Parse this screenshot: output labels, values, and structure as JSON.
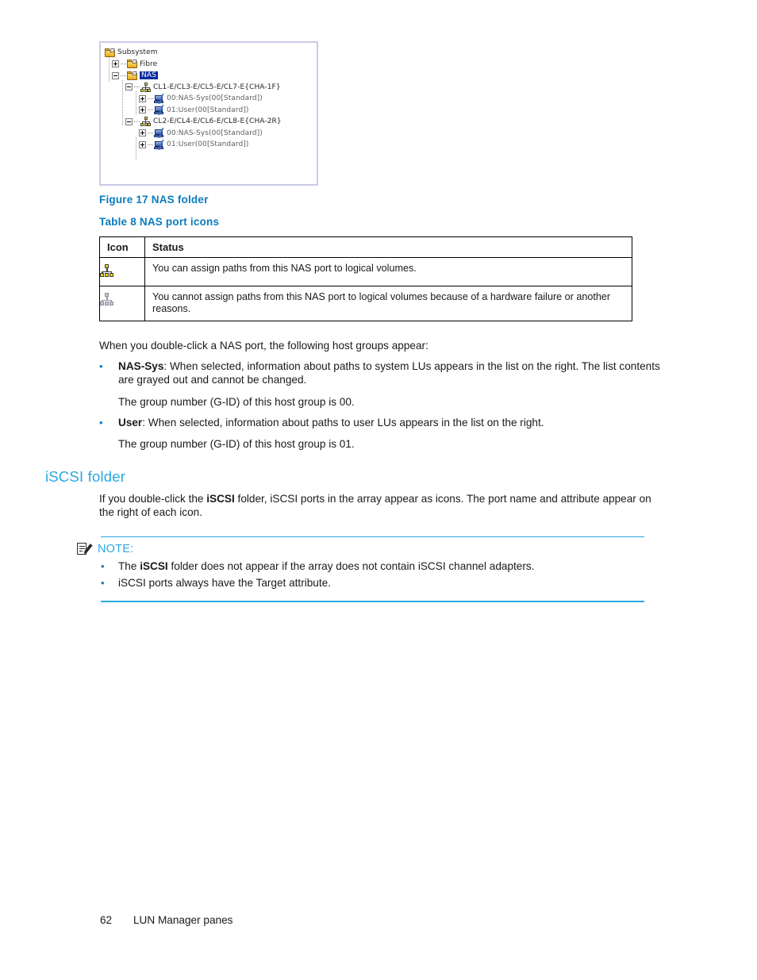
{
  "figure": {
    "caption": "Figure 17 NAS folder",
    "tree": {
      "root": {
        "label": "Subsystem",
        "icon": "folder-icon"
      },
      "nodes": [
        {
          "label": "Fibre",
          "icon": "folder-icon",
          "expander": "plus"
        },
        {
          "label": "NAS",
          "icon": "folder-icon",
          "expander": "minus",
          "selected": true
        },
        {
          "label": "CL1-E/CL3-E/CL5-E/CL7-E{CHA-1F}",
          "icon": "nas-port-icon",
          "expander": "minus"
        },
        {
          "label": "00:NAS-Sys(00[Standard])",
          "icon": "host-group-icon",
          "expander": "plus"
        },
        {
          "label": "01:User(00[Standard])",
          "icon": "host-group-icon",
          "expander": "plus"
        },
        {
          "label": "CL2-E/CL4-E/CL6-E/CL8-E{CHA-2R}",
          "icon": "nas-port-icon",
          "expander": "minus"
        },
        {
          "label": "00:NAS-Sys(00[Standard])",
          "icon": "host-group-icon",
          "expander": "plus"
        },
        {
          "label": "01:User(00[Standard])",
          "icon": "host-group-icon",
          "expander": "plus"
        }
      ]
    }
  },
  "table": {
    "caption": "Table 8 NAS port icons",
    "headers": [
      "Icon",
      "Status"
    ],
    "rows": [
      {
        "icon": "nas-port-available-icon",
        "status": "You can assign paths from this NAS port to logical volumes."
      },
      {
        "icon": "nas-port-unavailable-icon",
        "status": "You cannot assign paths from this NAS port to logical volumes because of a hardware failure or another reasons."
      }
    ]
  },
  "body": {
    "intro": "When you double-click a NAS port, the following host groups appear:",
    "bullets": [
      {
        "term": "NAS-Sys",
        "text": ": When selected, information about paths to system LUs appears in the list on the right. The list contents are grayed out and cannot be changed.",
        "note": "The group number (G-ID) of this host group is 00."
      },
      {
        "term": "User",
        "text": ": When selected, information about paths to user LUs appears in the list on the right.",
        "note": "The group number (G-ID) of this host group is 01."
      }
    ]
  },
  "section": {
    "heading": "iSCSI folder",
    "paragraph_pre": "If you double-click the ",
    "paragraph_bold": "iSCSI",
    "paragraph_post": " folder, iSCSI ports in the array appear as icons. The port name and attribute appear on the right of each icon."
  },
  "note": {
    "label": "NOTE:",
    "icon": "note-pencil-icon",
    "items": [
      {
        "pre": "The ",
        "bold": "iSCSI",
        "post": " folder does not appear if the array does not contain iSCSI channel adapters."
      },
      {
        "pre": "iSCSI ports always have the Target attribute.",
        "bold": "",
        "post": ""
      }
    ]
  },
  "footer": {
    "page": "62",
    "title": "LUN Manager panes"
  },
  "colors": {
    "accent_caption": "#0c7bbd",
    "accent_heading": "#2aa8e2",
    "panel_border": "#c9cbe8",
    "selection": "#0a2c9e",
    "port_available": "#f2d200",
    "port_unavailable": "#c9c9d6"
  }
}
